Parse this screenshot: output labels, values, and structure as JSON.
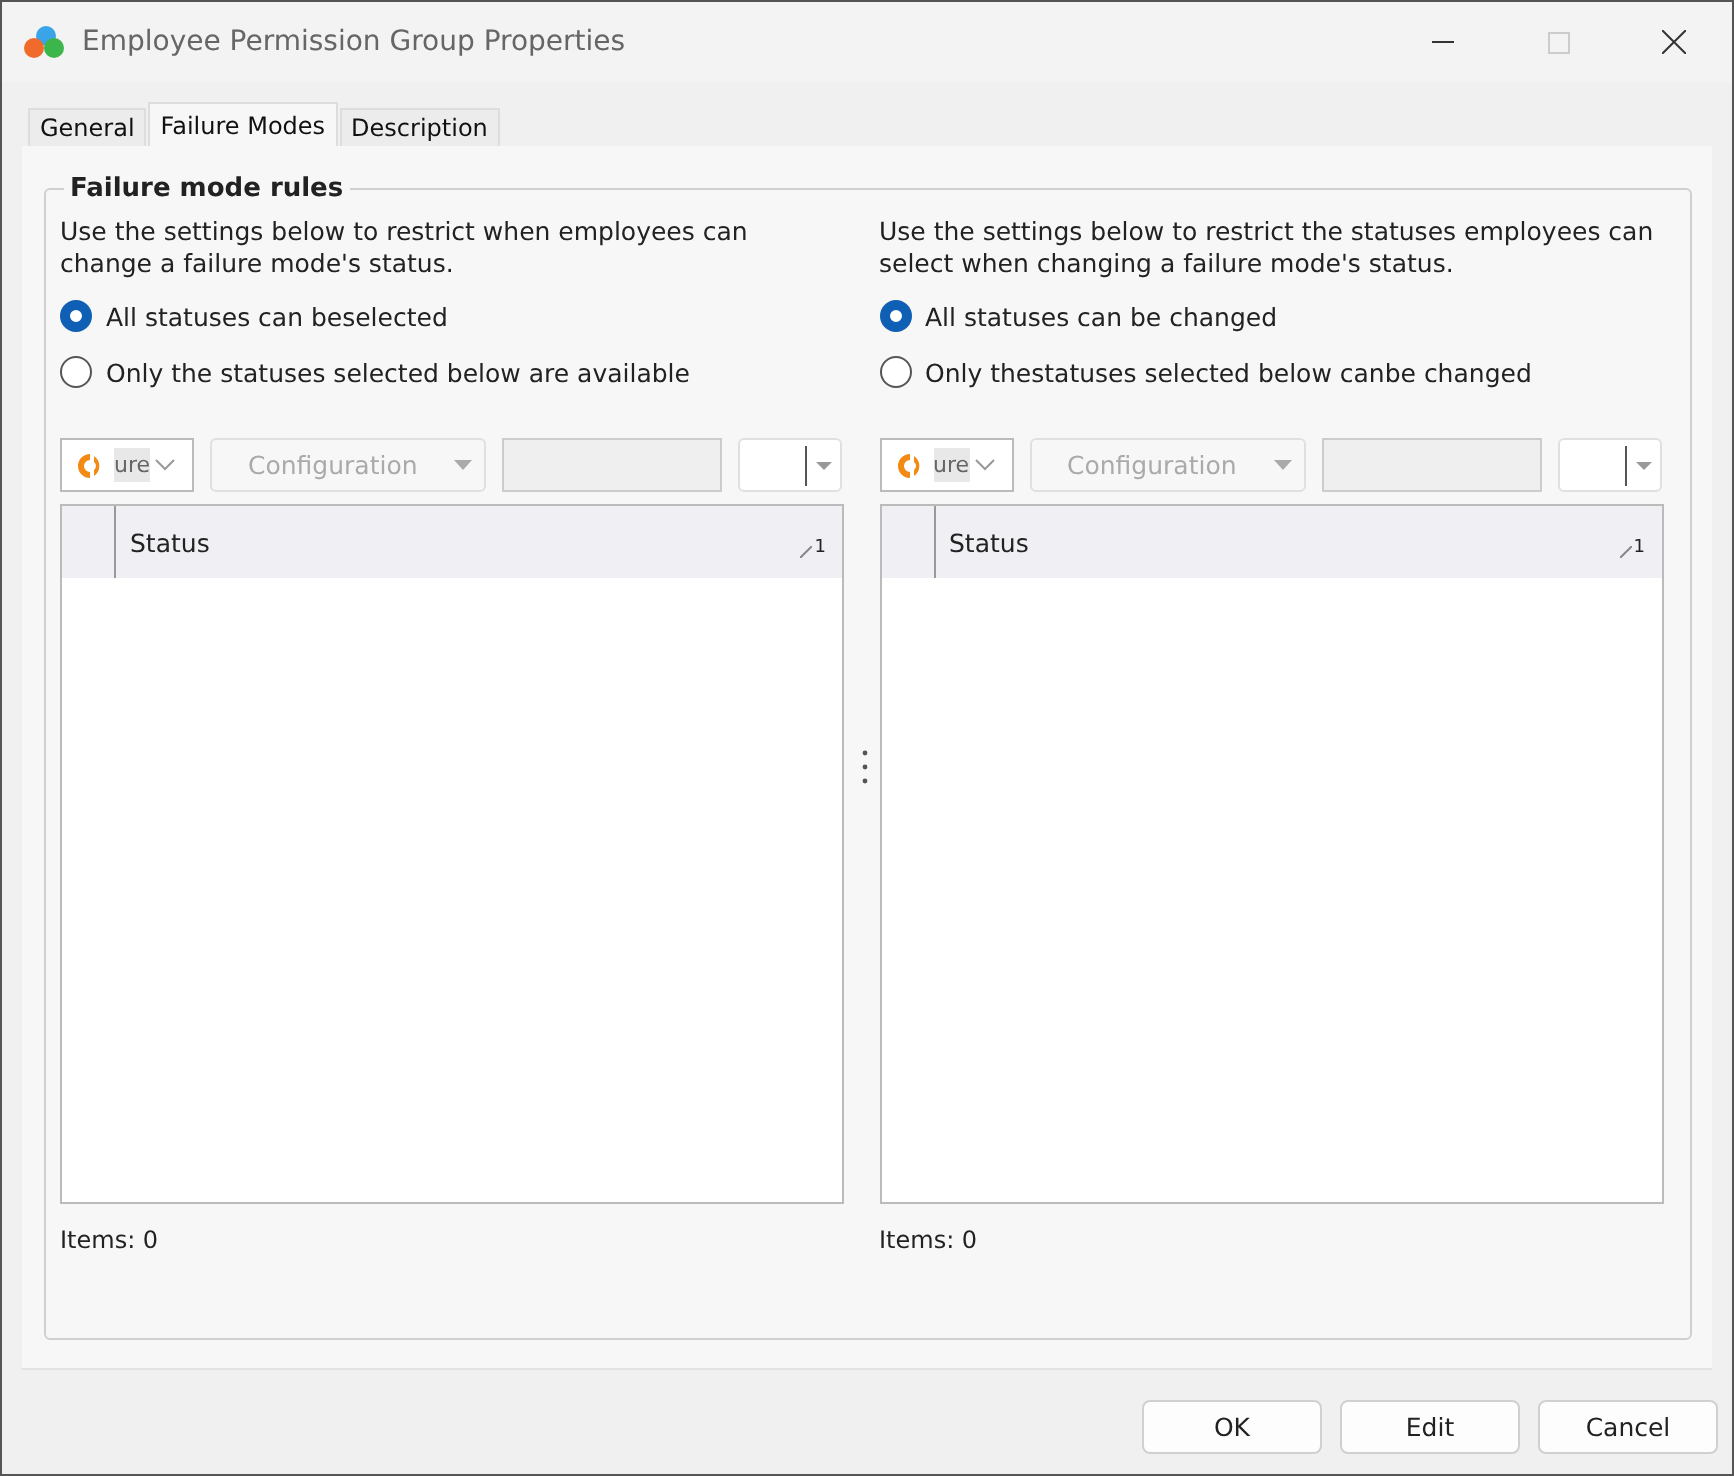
{
  "window": {
    "title": "Employee Permission Group Properties",
    "maximize_disabled": true
  },
  "tabs": [
    {
      "label": "General",
      "selected": false
    },
    {
      "label": "Failure Modes",
      "selected": true
    },
    {
      "label": "Description",
      "selected": false
    }
  ],
  "group": {
    "title": "Failure mode rules",
    "panes": [
      {
        "description": "Use the settings below to restrict when employees can change a failure mode's status.",
        "options": [
          {
            "label": "All statuses can beselected",
            "selected": true
          },
          {
            "label": "Only the statuses selected below are available",
            "selected": false
          }
        ],
        "toolbar": {
          "logo_text": "ure",
          "configuration": "Configuration",
          "configuration_disabled": true
        },
        "grid": {
          "column": "Status",
          "sort_index": "1"
        },
        "items": "Items: 0"
      },
      {
        "description": "Use the settings below to restrict the statuses employees can select when changing a failure mode's status.",
        "options": [
          {
            "label": "All statuses can be changed",
            "selected": true
          },
          {
            "label": "Only thestatuses selected below canbe changed",
            "selected": false
          }
        ],
        "toolbar": {
          "logo_text": "ure",
          "configuration": "Configuration",
          "configuration_disabled": true
        },
        "grid": {
          "column": "Status",
          "sort_index": "1"
        },
        "items": "Items: 0"
      }
    ]
  },
  "buttons": [
    {
      "label": "OK"
    },
    {
      "label": "Edit"
    },
    {
      "label": "Cancel"
    }
  ]
}
